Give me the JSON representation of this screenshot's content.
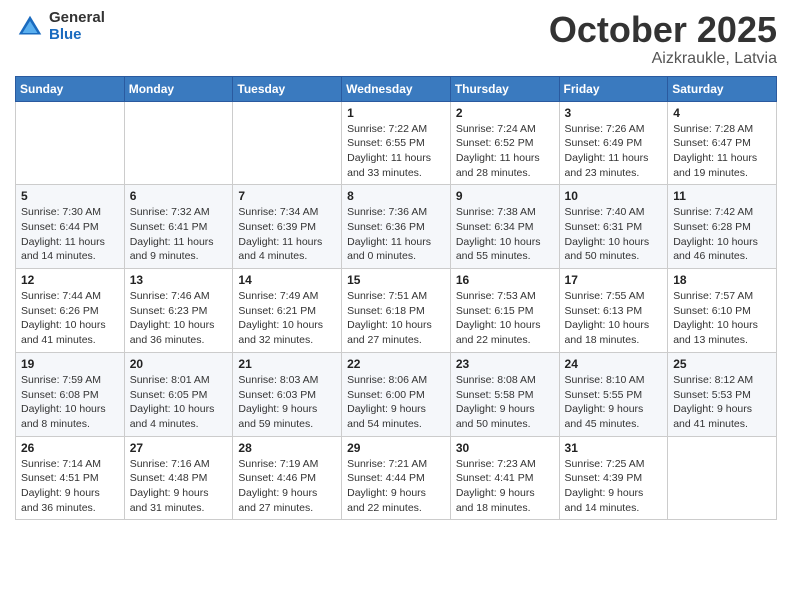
{
  "header": {
    "logo_general": "General",
    "logo_blue": "Blue",
    "month": "October 2025",
    "location": "Aizkraukle, Latvia"
  },
  "weekdays": [
    "Sunday",
    "Monday",
    "Tuesday",
    "Wednesday",
    "Thursday",
    "Friday",
    "Saturday"
  ],
  "weeks": [
    [
      {
        "day": "",
        "info": ""
      },
      {
        "day": "",
        "info": ""
      },
      {
        "day": "",
        "info": ""
      },
      {
        "day": "1",
        "info": "Sunrise: 7:22 AM\nSunset: 6:55 PM\nDaylight: 11 hours\nand 33 minutes."
      },
      {
        "day": "2",
        "info": "Sunrise: 7:24 AM\nSunset: 6:52 PM\nDaylight: 11 hours\nand 28 minutes."
      },
      {
        "day": "3",
        "info": "Sunrise: 7:26 AM\nSunset: 6:49 PM\nDaylight: 11 hours\nand 23 minutes."
      },
      {
        "day": "4",
        "info": "Sunrise: 7:28 AM\nSunset: 6:47 PM\nDaylight: 11 hours\nand 19 minutes."
      }
    ],
    [
      {
        "day": "5",
        "info": "Sunrise: 7:30 AM\nSunset: 6:44 PM\nDaylight: 11 hours\nand 14 minutes."
      },
      {
        "day": "6",
        "info": "Sunrise: 7:32 AM\nSunset: 6:41 PM\nDaylight: 11 hours\nand 9 minutes."
      },
      {
        "day": "7",
        "info": "Sunrise: 7:34 AM\nSunset: 6:39 PM\nDaylight: 11 hours\nand 4 minutes."
      },
      {
        "day": "8",
        "info": "Sunrise: 7:36 AM\nSunset: 6:36 PM\nDaylight: 11 hours\nand 0 minutes."
      },
      {
        "day": "9",
        "info": "Sunrise: 7:38 AM\nSunset: 6:34 PM\nDaylight: 10 hours\nand 55 minutes."
      },
      {
        "day": "10",
        "info": "Sunrise: 7:40 AM\nSunset: 6:31 PM\nDaylight: 10 hours\nand 50 minutes."
      },
      {
        "day": "11",
        "info": "Sunrise: 7:42 AM\nSunset: 6:28 PM\nDaylight: 10 hours\nand 46 minutes."
      }
    ],
    [
      {
        "day": "12",
        "info": "Sunrise: 7:44 AM\nSunset: 6:26 PM\nDaylight: 10 hours\nand 41 minutes."
      },
      {
        "day": "13",
        "info": "Sunrise: 7:46 AM\nSunset: 6:23 PM\nDaylight: 10 hours\nand 36 minutes."
      },
      {
        "day": "14",
        "info": "Sunrise: 7:49 AM\nSunset: 6:21 PM\nDaylight: 10 hours\nand 32 minutes."
      },
      {
        "day": "15",
        "info": "Sunrise: 7:51 AM\nSunset: 6:18 PM\nDaylight: 10 hours\nand 27 minutes."
      },
      {
        "day": "16",
        "info": "Sunrise: 7:53 AM\nSunset: 6:15 PM\nDaylight: 10 hours\nand 22 minutes."
      },
      {
        "day": "17",
        "info": "Sunrise: 7:55 AM\nSunset: 6:13 PM\nDaylight: 10 hours\nand 18 minutes."
      },
      {
        "day": "18",
        "info": "Sunrise: 7:57 AM\nSunset: 6:10 PM\nDaylight: 10 hours\nand 13 minutes."
      }
    ],
    [
      {
        "day": "19",
        "info": "Sunrise: 7:59 AM\nSunset: 6:08 PM\nDaylight: 10 hours\nand 8 minutes."
      },
      {
        "day": "20",
        "info": "Sunrise: 8:01 AM\nSunset: 6:05 PM\nDaylight: 10 hours\nand 4 minutes."
      },
      {
        "day": "21",
        "info": "Sunrise: 8:03 AM\nSunset: 6:03 PM\nDaylight: 9 hours\nand 59 minutes."
      },
      {
        "day": "22",
        "info": "Sunrise: 8:06 AM\nSunset: 6:00 PM\nDaylight: 9 hours\nand 54 minutes."
      },
      {
        "day": "23",
        "info": "Sunrise: 8:08 AM\nSunset: 5:58 PM\nDaylight: 9 hours\nand 50 minutes."
      },
      {
        "day": "24",
        "info": "Sunrise: 8:10 AM\nSunset: 5:55 PM\nDaylight: 9 hours\nand 45 minutes."
      },
      {
        "day": "25",
        "info": "Sunrise: 8:12 AM\nSunset: 5:53 PM\nDaylight: 9 hours\nand 41 minutes."
      }
    ],
    [
      {
        "day": "26",
        "info": "Sunrise: 7:14 AM\nSunset: 4:51 PM\nDaylight: 9 hours\nand 36 minutes."
      },
      {
        "day": "27",
        "info": "Sunrise: 7:16 AM\nSunset: 4:48 PM\nDaylight: 9 hours\nand 31 minutes."
      },
      {
        "day": "28",
        "info": "Sunrise: 7:19 AM\nSunset: 4:46 PM\nDaylight: 9 hours\nand 27 minutes."
      },
      {
        "day": "29",
        "info": "Sunrise: 7:21 AM\nSunset: 4:44 PM\nDaylight: 9 hours\nand 22 minutes."
      },
      {
        "day": "30",
        "info": "Sunrise: 7:23 AM\nSunset: 4:41 PM\nDaylight: 9 hours\nand 18 minutes."
      },
      {
        "day": "31",
        "info": "Sunrise: 7:25 AM\nSunset: 4:39 PM\nDaylight: 9 hours\nand 14 minutes."
      },
      {
        "day": "",
        "info": ""
      }
    ]
  ]
}
